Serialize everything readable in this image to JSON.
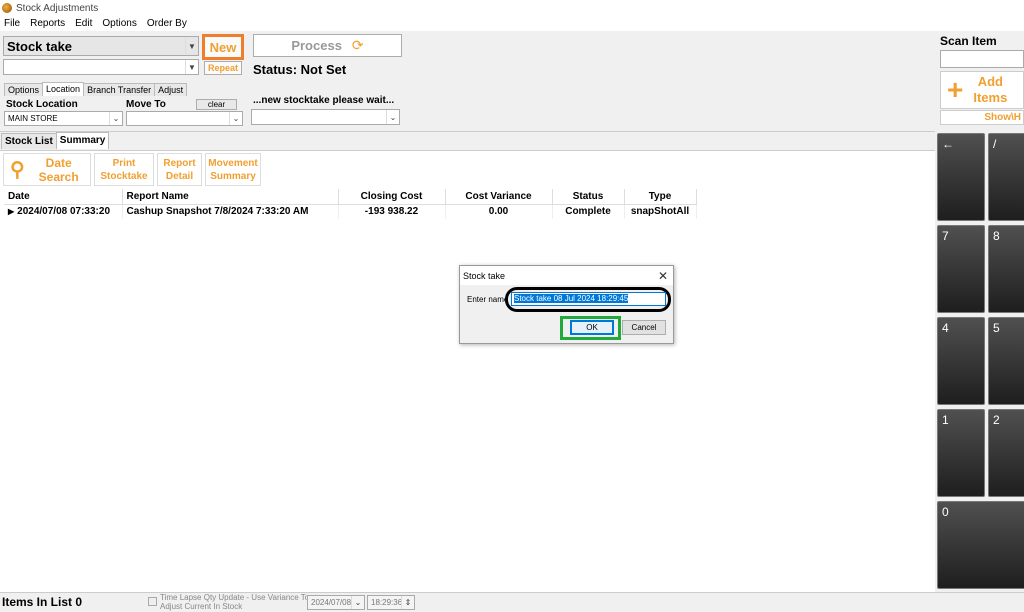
{
  "window": {
    "title": "Stock Adjustments"
  },
  "menu": [
    "File",
    "Reports",
    "Edit",
    "Options",
    "Order By"
  ],
  "header": {
    "mode_select": "Stock take",
    "sub_select": "",
    "new_button": "New",
    "repeat_button": "Repeat",
    "process_button": "Process",
    "status": "Status: Not Set",
    "wait_message": "...new stocktake please wait...",
    "wait_select": ""
  },
  "location_tabs": [
    "Options",
    "Location",
    "Branch Transfer",
    "Adjust"
  ],
  "location_tabs_active": "Location",
  "location": {
    "stock_location_label": "Stock Location",
    "stock_location_value": "MAIN STORE",
    "move_to_label": "Move To",
    "move_to_value": "",
    "clear_button": "clear"
  },
  "scan": {
    "title": "Scan Item",
    "input_value": "",
    "add_items": "Add Items",
    "add_items_line1": "Add",
    "add_items_line2": "Items",
    "show_hide": "Show\\H"
  },
  "list_tabs": [
    "Stock List",
    "Summary"
  ],
  "list_tabs_active": "Summary",
  "toolbar": {
    "date_search": "Date Search",
    "date_search_l1": "Date",
    "date_search_l2": "Search",
    "print_stocktake_l1": "Print",
    "print_stocktake_l2": "Stocktake",
    "report_detail_l1": "Report",
    "report_detail_l2": "Detail",
    "movement_summary_l1": "Movement",
    "movement_summary_l2": "Summary"
  },
  "table": {
    "columns": [
      "Date",
      "Report Name",
      "Closing Cost",
      "Cost Variance",
      "Status",
      "Type"
    ],
    "rows": [
      [
        "2024/07/08 07:33:20",
        "Cashup Snapshot 7/8/2024 7:33:20 AM",
        "-193 938.22",
        "0.00",
        "Complete",
        "snapShotAll"
      ]
    ]
  },
  "keypad": [
    "←",
    "/",
    "7",
    "8",
    "4",
    "5",
    "1",
    "2",
    "0"
  ],
  "status_bar": {
    "items_in_list": "Items In List 0",
    "time_lapse_line1": "Time Lapse Qty Update - Use Variance To",
    "time_lapse_line2": "Adjust Current In Stock",
    "date_value": "2024/07/08",
    "time_value": "18:29:36"
  },
  "dialog": {
    "title": "Stock take",
    "label": "Enter name",
    "name_value": "Stock take 08 Jul 2024 18:29:45",
    "ok": "OK",
    "cancel": "Cancel"
  },
  "colors": {
    "accent": "#f0a030",
    "highlight_new": "#f07d2a",
    "highlight_ok": "#1faa3a",
    "selection": "#0078d7"
  }
}
